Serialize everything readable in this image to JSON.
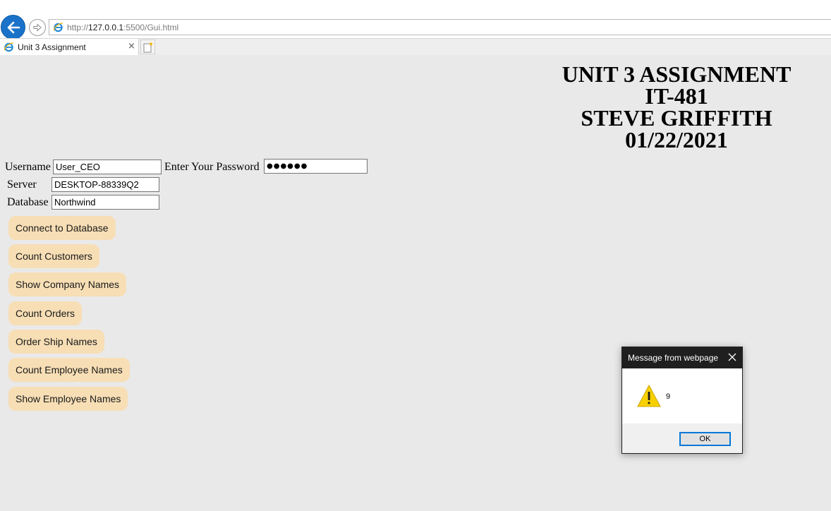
{
  "browser": {
    "url_prefix": "http://",
    "url_host": "127.0.0.1",
    "url_rest": ":5500/Gui.html",
    "tab_title": "Unit 3 Assignment",
    "tab_close": "×"
  },
  "header": {
    "line1": "UNIT 3 ASSIGNMENT",
    "line2": "IT-481",
    "line3": "STEVE GRIFFITH",
    "line4": "01/22/2021"
  },
  "form": {
    "username_label": "Username",
    "username_value": "User_CEO",
    "password_label": "Enter Your Password",
    "password_value": "●●●●●●",
    "server_label": "Server",
    "server_value": "DESKTOP-88339Q2",
    "database_label": "Database",
    "database_value": "Northwind"
  },
  "buttons": {
    "connect": "Connect to Database",
    "count_customers": "Count Customers",
    "show_company_names": "Show Company Names",
    "count_orders": "Count Orders",
    "order_ship_names": "Order Ship Names",
    "count_employee_names": "Count Employee Names",
    "show_employee_names": "Show Employee Names"
  },
  "dialog": {
    "title": "Message from webpage",
    "message": "9",
    "ok_label": "OK",
    "icon": "warning-icon"
  },
  "colors": {
    "button_bg": "#f7deb5",
    "page_bg": "#e9e9e9",
    "back_button": "#1a73c9",
    "dialog_titlebar": "#1f1f1f",
    "ok_border": "#0078d7"
  }
}
